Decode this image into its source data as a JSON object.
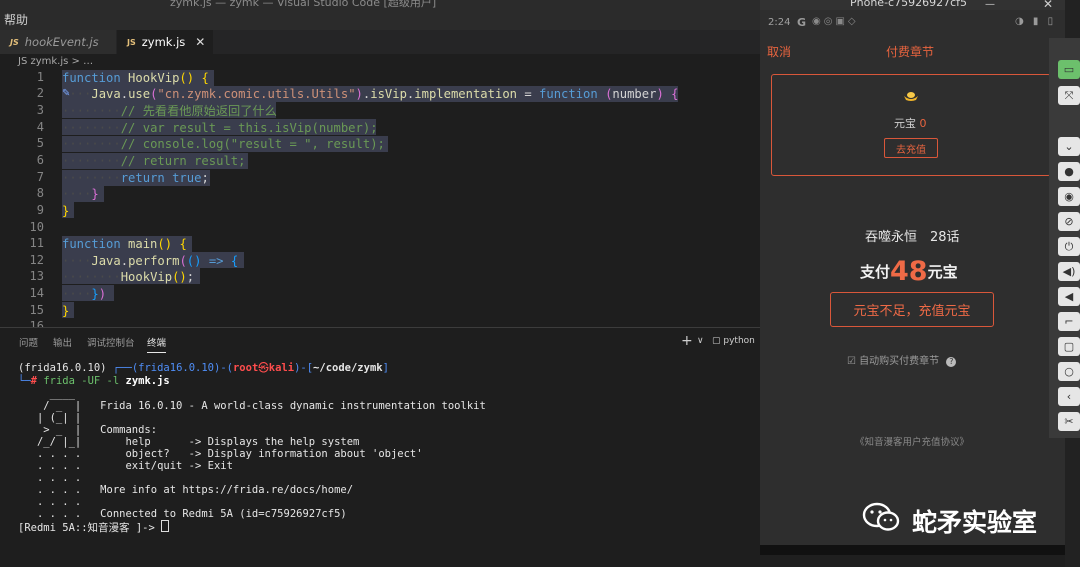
{
  "window": {
    "title_fragment": "zymk.js — zymk — Visual Studio Code [超级用户]",
    "menu": "帮助"
  },
  "tabs": [
    {
      "icon": "JS",
      "label": "hookEvent.js"
    },
    {
      "icon": "JS",
      "label": "zymk.js",
      "close": "✕"
    }
  ],
  "breadcrumb": "JS zymk.js > …",
  "editor": {
    "line_numbers": [
      "1",
      "2",
      "3",
      "4",
      "5",
      "6",
      "7",
      "8",
      "9",
      "10",
      "11",
      "12",
      "13",
      "14",
      "15",
      "16"
    ]
  },
  "panel": {
    "tabs": [
      "问题",
      "输出",
      "调试控制台",
      "终端"
    ],
    "plus": "+",
    "chevron": "∨",
    "terminal_name": "python"
  },
  "terminal": {
    "prompt_env": "(frida16.0.10)",
    "prompt_env2": "(frida16.0.10)",
    "prompt_user": "root",
    "prompt_at": "㉿",
    "prompt_host": "kali",
    "prompt_path": "~/code/zymk",
    "command": "frida -UF -l zymk.js",
    "banner": [
      "     ____",
      "    / _  |   Frida 16.0.10 - A world-class dynamic instrumentation toolkit",
      "   | (_| |",
      "    > _  |   Commands:",
      "   /_/ |_|       help      -> Displays the help system",
      "   . . . .       object?   -> Display information about 'object'",
      "   . . . .       exit/quit -> Exit",
      "   . . . .",
      "   . . . .   More info at https://frida.re/docs/home/",
      "   . . . .",
      "   . . . .   Connected to Redmi 5A (id=c75926927cf5)"
    ],
    "repl": "[Redmi 5A::知音漫客 ]-> "
  },
  "phone": {
    "window_title": "Phone-c75926927cf5",
    "status_time": "2:24",
    "status_g": "G",
    "cancel": "取消",
    "title": "付费章节",
    "yuanbao_label": "元宝",
    "yuanbao_value": "0",
    "recharge": "去充值",
    "comic": "吞噬永恒　28话",
    "pay_prefix": "支付",
    "pay_amount": "48",
    "pay_suffix": "元宝",
    "pay_button": "元宝不足，充值元宝",
    "auto_buy": "自动购买付费章节",
    "agreement": "《知音漫客用户充值协议》",
    "watermark": "蛇矛实验室"
  },
  "colors": {
    "accent": "#e8643f",
    "editor_bg": "#1e1e1e",
    "selection": "#3a3d4d"
  }
}
